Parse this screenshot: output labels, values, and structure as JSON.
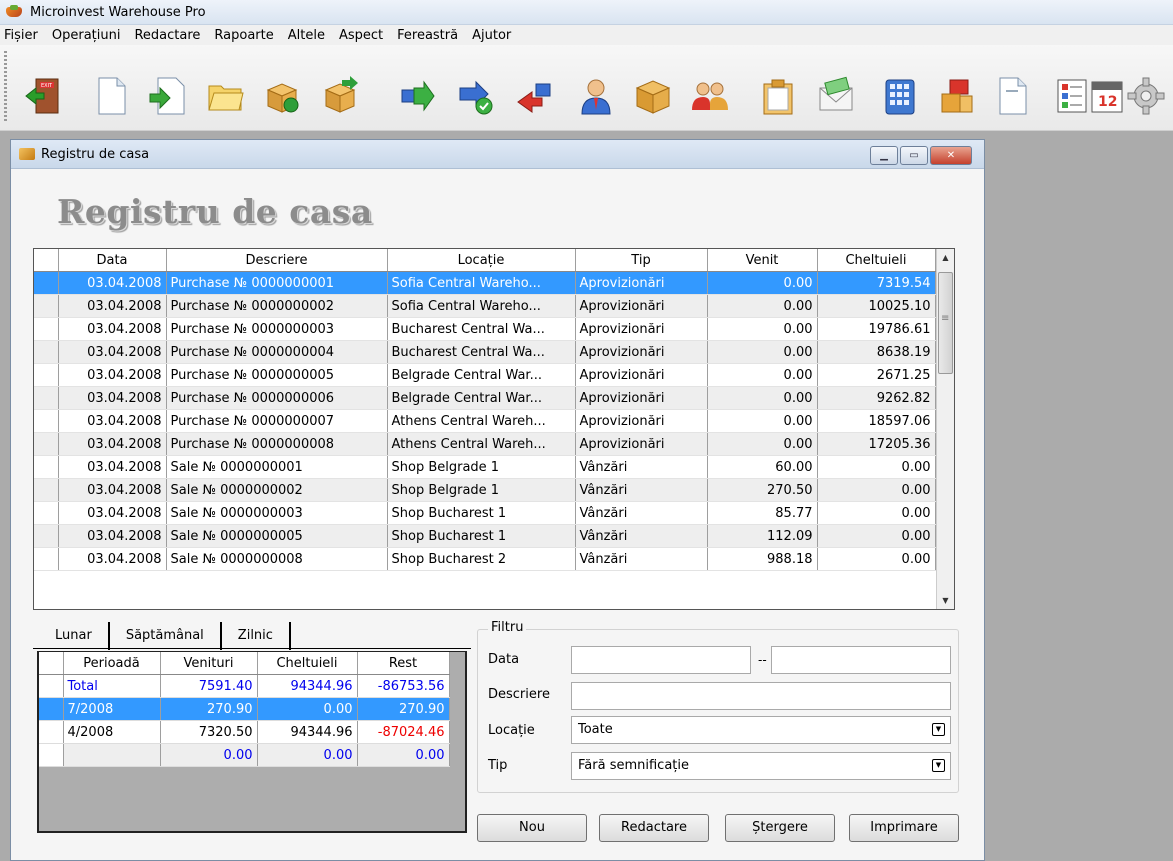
{
  "app": {
    "title": "Microinvest Warehouse Pro"
  },
  "menu": [
    "Fișier",
    "Operațiuni",
    "Redactare",
    "Rapoarte",
    "Altele",
    "Aspect",
    "Fereastră",
    "Ajutor"
  ],
  "toolbar_icons": [
    "exit-door-icon",
    "new-document-icon",
    "import-document-icon",
    "folder-icon",
    "delivery-box-icon",
    "box-arrow-icon",
    "transfer-right-icon",
    "transfer-check-icon",
    "transfer-left-icon",
    "user-icon",
    "package-icon",
    "partners-icon",
    "clipboard-icon",
    "envelope-money-icon",
    "building-icon",
    "stacked-boxes-icon",
    "report-document-icon",
    "list-report-icon",
    "calendar-icon",
    "gear-icon"
  ],
  "window": {
    "title": "Registru de casa",
    "heading": "Registru de casa"
  },
  "grid": {
    "columns": [
      "Data",
      "Descriere",
      "Locație",
      "Tip",
      "Venit",
      "Cheltuieli"
    ],
    "rows": [
      [
        "03.04.2008",
        "Purchase № 0000000001",
        "Sofia Central Wareho...",
        "Aprovizionări",
        "0.00",
        "7319.54"
      ],
      [
        "03.04.2008",
        "Purchase № 0000000002",
        "Sofia Central Wareho...",
        "Aprovizionări",
        "0.00",
        "10025.10"
      ],
      [
        "03.04.2008",
        "Purchase № 0000000003",
        "Bucharest Central Wa...",
        "Aprovizionări",
        "0.00",
        "19786.61"
      ],
      [
        "03.04.2008",
        "Purchase № 0000000004",
        "Bucharest Central Wa...",
        "Aprovizionări",
        "0.00",
        "8638.19"
      ],
      [
        "03.04.2008",
        "Purchase № 0000000005",
        "Belgrade Central War...",
        "Aprovizionări",
        "0.00",
        "2671.25"
      ],
      [
        "03.04.2008",
        "Purchase № 0000000006",
        "Belgrade Central War...",
        "Aprovizionări",
        "0.00",
        "9262.82"
      ],
      [
        "03.04.2008",
        "Purchase № 0000000007",
        "Athens Central Wareh...",
        "Aprovizionări",
        "0.00",
        "18597.06"
      ],
      [
        "03.04.2008",
        "Purchase № 0000000008",
        "Athens Central Wareh...",
        "Aprovizionări",
        "0.00",
        "17205.36"
      ],
      [
        "03.04.2008",
        "Sale № 0000000001",
        "Shop Belgrade 1",
        "Vânzări",
        "60.00",
        "0.00"
      ],
      [
        "03.04.2008",
        "Sale № 0000000002",
        "Shop Belgrade 1",
        "Vânzări",
        "270.50",
        "0.00"
      ],
      [
        "03.04.2008",
        "Sale № 0000000003",
        "Shop Bucharest 1",
        "Vânzări",
        "85.77",
        "0.00"
      ],
      [
        "03.04.2008",
        "Sale № 0000000005",
        "Shop Bucharest 1",
        "Vânzări",
        "112.09",
        "0.00"
      ],
      [
        "03.04.2008",
        "Sale № 0000000008",
        "Shop Bucharest 2",
        "Vânzări",
        "988.18",
        "0.00"
      ]
    ]
  },
  "tabs": [
    "Lunar",
    "Săptămânal",
    "Zilnic"
  ],
  "summary": {
    "columns": [
      "Perioadă",
      "Venituri",
      "Cheltuieli",
      "Rest"
    ],
    "rows": [
      [
        "Total",
        "7591.40",
        "94344.96",
        "-86753.56"
      ],
      [
        "7/2008",
        "270.90",
        "0.00",
        "270.90"
      ],
      [
        "4/2008",
        "7320.50",
        "94344.96",
        "-87024.46"
      ],
      [
        "",
        "0.00",
        "0.00",
        "0.00"
      ]
    ]
  },
  "filter": {
    "legend": "Filtru",
    "date_label": "Data",
    "date_from": "",
    "date_sep": "--",
    "date_to": "",
    "desc_label": "Descriere",
    "desc_value": "",
    "loc_label": "Locație",
    "loc_value": "Toate",
    "type_label": "Tip",
    "type_value": "Fără semnificație"
  },
  "buttons": {
    "new": "Nou",
    "edit": "Redactare",
    "delete": "Ștergere",
    "print": "Imprimare"
  }
}
